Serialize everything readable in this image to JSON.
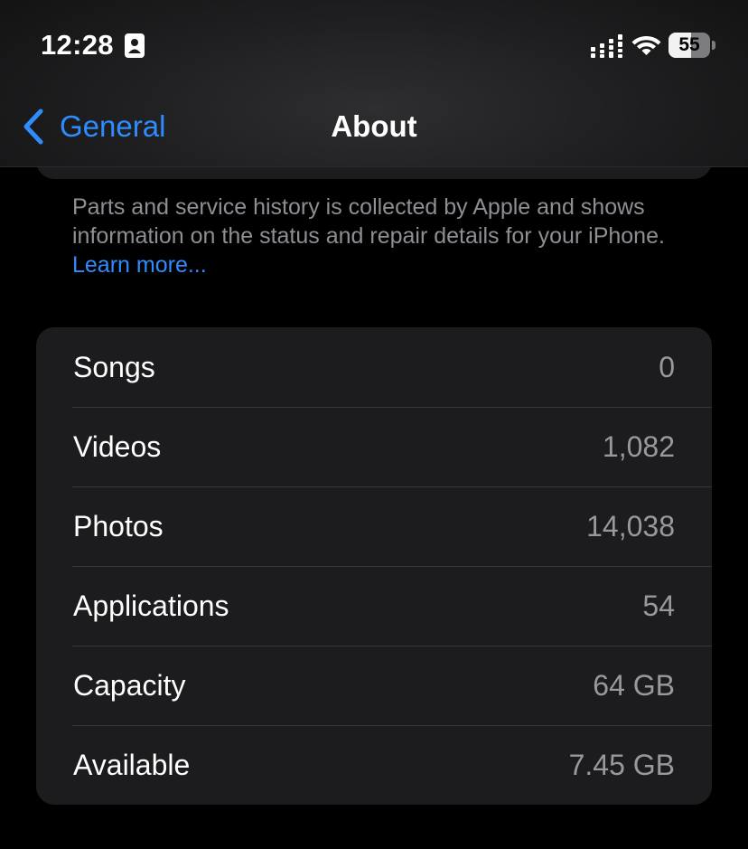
{
  "status_bar": {
    "time": "12:28",
    "battery": "55",
    "battery_level": 0.55,
    "icons": [
      "contact-card-icon",
      "cellular-signal-icon",
      "wifi-icon",
      "battery-icon"
    ]
  },
  "nav": {
    "back_label": "General",
    "title": "About"
  },
  "parts_service": {
    "note": "Parts and service history is collected by Apple and shows information on the status and repair details for your iPhone. ",
    "link": "Learn more..."
  },
  "stats": [
    {
      "label": "Songs",
      "value": "0"
    },
    {
      "label": "Videos",
      "value": "1,082"
    },
    {
      "label": "Photos",
      "value": "14,038"
    },
    {
      "label": "Applications",
      "value": "54"
    },
    {
      "label": "Capacity",
      "value": "64 GB"
    },
    {
      "label": "Available",
      "value": "7.45 GB"
    }
  ],
  "colors": {
    "accent": "#2f8cff",
    "background": "#000000",
    "card": "#1c1c1e",
    "secondary_text": "#98989d"
  }
}
